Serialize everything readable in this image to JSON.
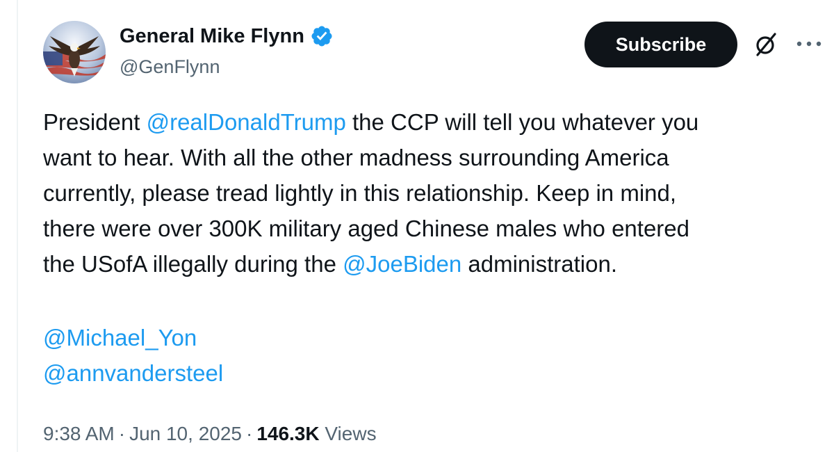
{
  "author": {
    "display_name": "General Mike Flynn",
    "handle": "@GenFlynn",
    "verified_icon": "verified-badge-icon",
    "avatar_icon": "eagle-flag-avatar"
  },
  "actions": {
    "subscribe_label": "Subscribe",
    "grok_icon": "grok-icon",
    "more_icon": "more-options-icon"
  },
  "tweet": {
    "line1_prefix": "President ",
    "line1_mention": "@realDonaldTrump",
    "line1_suffix": " the CCP will tell you whatever you",
    "line2": "want to hear. With all the other madness surrounding America",
    "line3": "currently, please tread lightly in this relationship. Keep in mind,",
    "line4": "there were over 300K military aged Chinese males who entered",
    "line5_prefix": "the USofA illegally during the ",
    "line5_mention": "@JoeBiden",
    "line5_suffix": " administration.",
    "mentions": [
      "@Michael_Yon",
      "@annvandersteel"
    ]
  },
  "meta": {
    "time": "9:38 AM",
    "date": "Jun 10, 2025",
    "separator": "·",
    "views_count": "146.3K",
    "views_label": "Views"
  },
  "colors": {
    "link": "#1d9bf0",
    "verified": "#1d9bf0",
    "text": "#0f1419",
    "secondary": "#536471",
    "button_bg": "#0f1419"
  }
}
